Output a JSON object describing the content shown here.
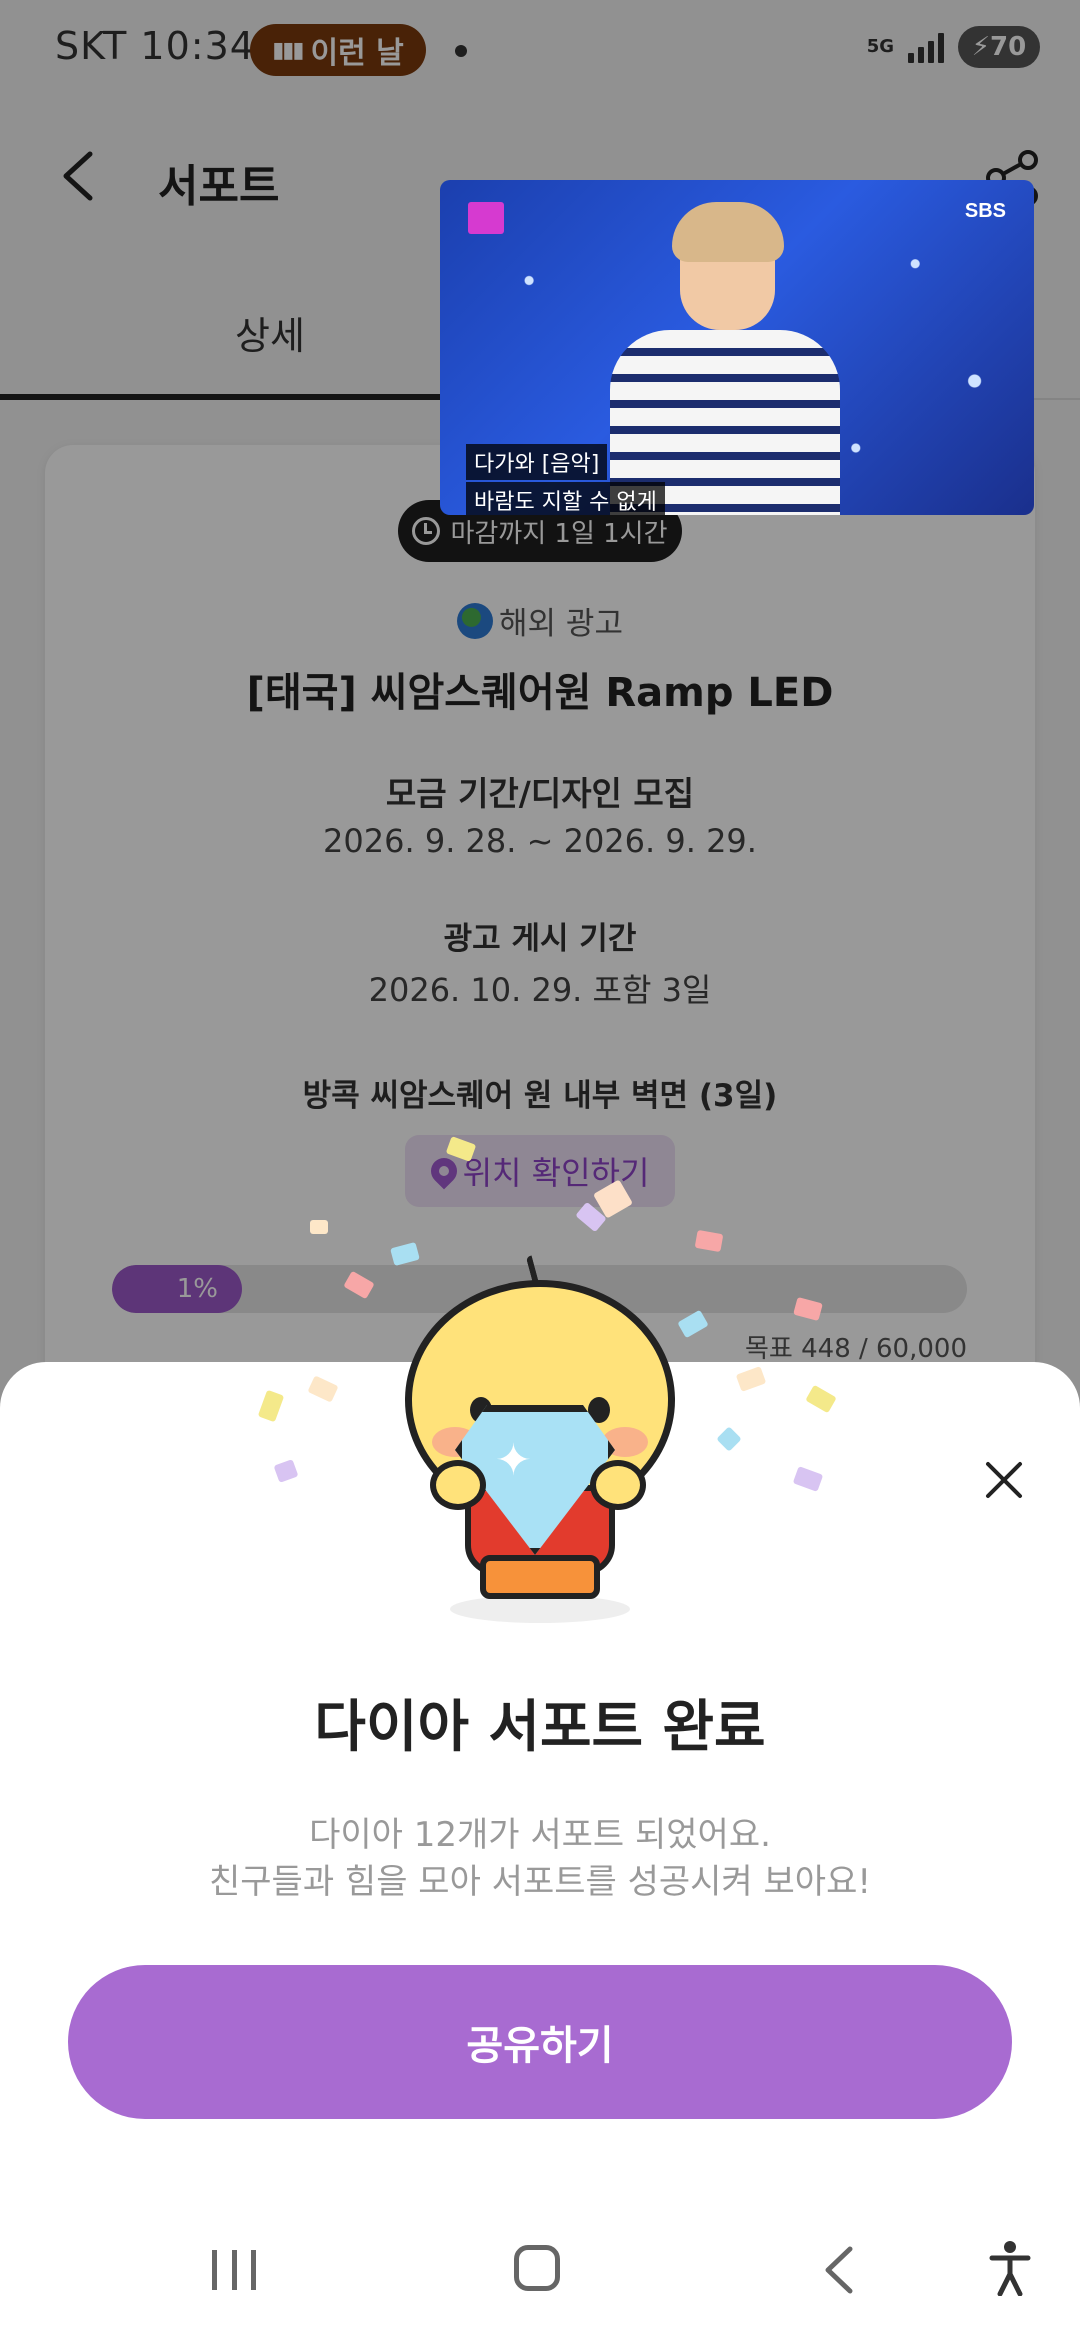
{
  "status_bar": {
    "carrier": "SKT",
    "time": "10:34",
    "pill_label": "이런 날",
    "network": "5G",
    "battery": "70"
  },
  "header": {
    "title": "서포트"
  },
  "tabs": {
    "detail": "상세"
  },
  "video": {
    "subtitle_line1": "다가와 [음악]",
    "subtitle_line2": "바람도 지할 수 없게",
    "channel": "SBS"
  },
  "campaign": {
    "deadline": "마감까지 1일 1시간",
    "category": "해외 광고",
    "title": "[태국] 씨암스퀘어원 Ramp LED",
    "funding_label": "모금 기간/디자인 모집",
    "funding_dates": "2026. 9. 28. ~ 2026. 9. 29.",
    "posting_label": "광고 게시 기간",
    "posting_dates": "2026. 10. 29. 포함 3일",
    "location_desc": "방콕 씨암스퀘어 원 내부 벽면 (3일)",
    "location_button": "위치 확인하기",
    "progress_percent": 1,
    "progress_label": "1%",
    "goal_text": "목표 448 / 60,000"
  },
  "sheet": {
    "title": "다이아 서포트 완료",
    "desc_line1": "다이아 12개가 서포트 되었어요.",
    "desc_line2": "친구들과 힘을 모아 서포트를 성공시켜 보아요!",
    "share_label": "공유하기"
  },
  "colors": {
    "accent": "#a86bd1",
    "progress": "#9b59c9",
    "badge_bg": "#1e1e1e"
  }
}
